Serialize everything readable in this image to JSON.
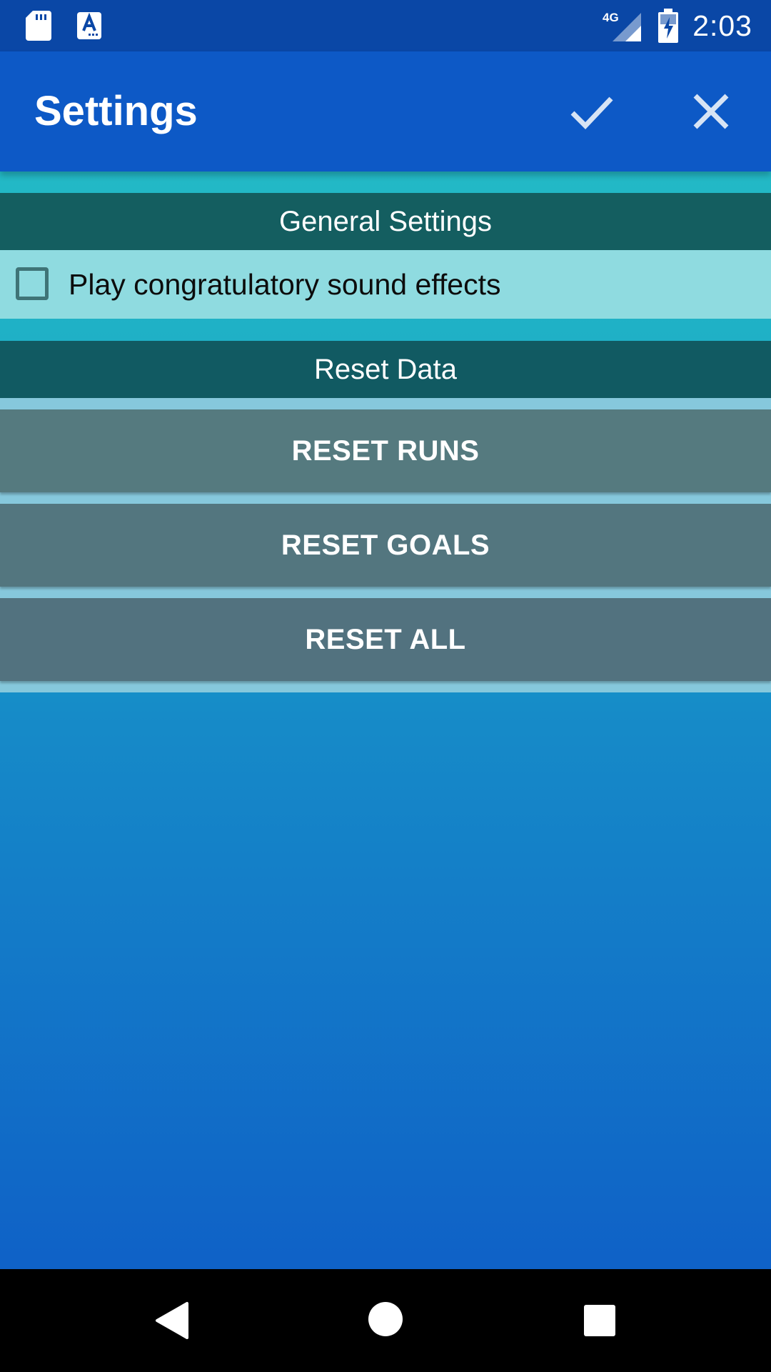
{
  "status_bar": {
    "network_label": "4G",
    "time": "2:03",
    "icons": [
      "sd-card-icon",
      "keyboard-a-icon",
      "signal-icon",
      "battery-charging-icon"
    ]
  },
  "app_bar": {
    "title": "Settings",
    "actions": [
      "check-icon",
      "close-icon"
    ]
  },
  "general_settings": {
    "header": "General Settings",
    "sound_effects": {
      "label": "Play congratulatory sound effects",
      "checked": false
    }
  },
  "reset_data": {
    "header": "Reset Data",
    "buttons": [
      {
        "label": "RESET RUNS"
      },
      {
        "label": "RESET GOALS"
      },
      {
        "label": "RESET ALL"
      }
    ]
  },
  "nav_bar": {
    "icons": [
      "back-icon",
      "home-icon",
      "recents-icon"
    ]
  },
  "colors": {
    "status_bar": "#0a47a6",
    "app_bar": "#0d59c6",
    "section_header": "#145e60",
    "checkbox_row": "#8fdbe0",
    "reset_button": "#557a7f"
  }
}
